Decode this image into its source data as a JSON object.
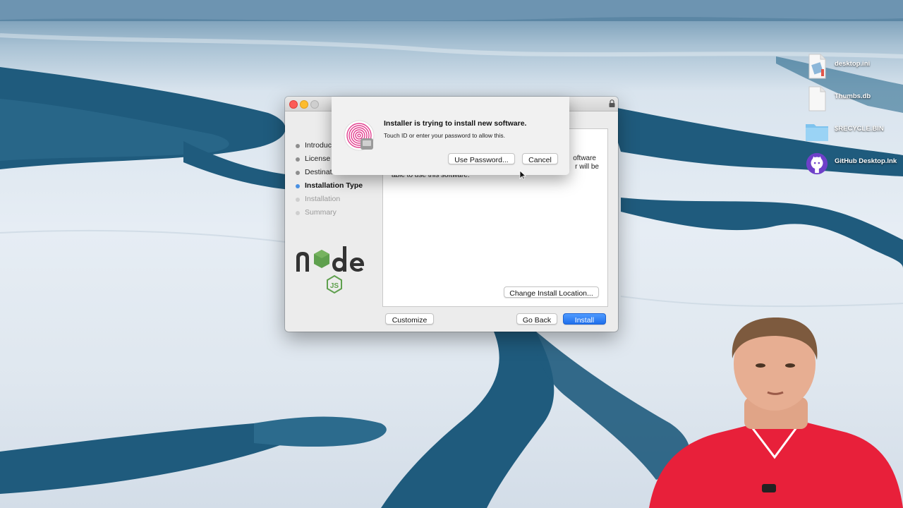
{
  "desktop": {
    "icons": [
      {
        "name": "desktop.ini",
        "icon": "document-icon"
      },
      {
        "name": "Thumbs.db",
        "icon": "document-icon"
      },
      {
        "name": "$RECYCLE.BIN",
        "icon": "folder-icon"
      },
      {
        "name": "GitHub Desktop.lnk",
        "icon": "github-icon"
      }
    ]
  },
  "installer": {
    "steps": [
      {
        "label": "Introduction",
        "state": "done"
      },
      {
        "label": "License",
        "state": "done"
      },
      {
        "label": "Destination Select",
        "state": "done"
      },
      {
        "label": "Installation Type",
        "state": "active"
      },
      {
        "label": "Installation",
        "state": "future"
      },
      {
        "label": "Summary",
        "state": "future"
      }
    ],
    "pane_text": {
      "line1": "oftware",
      "line2": "r will be",
      "line3": "able to use this software."
    },
    "change_location_label": "Change Install Location...",
    "customize_label": "Customize",
    "go_back_label": "Go Back",
    "install_label": "Install"
  },
  "auth_dialog": {
    "title": "Installer is trying to install new software.",
    "subtitle": "Touch ID or enter your password to allow this.",
    "use_password_label": "Use Password...",
    "cancel_label": "Cancel"
  },
  "colors": {
    "accent": "#2c7ff5",
    "active_step": "#4a90e2",
    "node_green": "#5fa04e",
    "touch_pink": "#e23f8f"
  }
}
